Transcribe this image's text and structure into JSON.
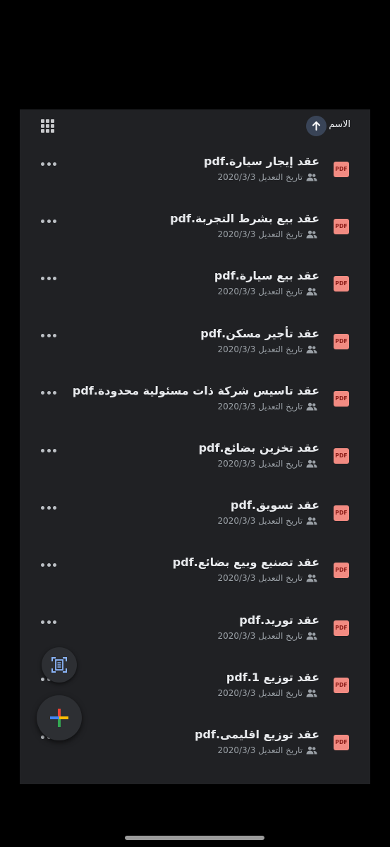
{
  "sort": {
    "label": "الاسم",
    "direction": "ascending"
  },
  "view_toggle_icon": "grid-view-icon",
  "file_type_badge": "PDF",
  "files": [
    {
      "name": "عقد إيجار سيارة.pdf",
      "meta": "تاريخ التعديل 2020/3/3"
    },
    {
      "name": "عقد بيع بشرط التجربة.pdf",
      "meta": "تاريخ التعديل 2020/3/3"
    },
    {
      "name": "عقد بيع سيارة.pdf",
      "meta": "تاريخ التعديل 2020/3/3"
    },
    {
      "name": "عقد تأجير مسكن.pdf",
      "meta": "تاريخ التعديل 2020/3/3"
    },
    {
      "name": "عقد تاسيس شركة ذات مسئولية محدودة.pdf",
      "meta": "تاريخ التعديل 2020/3/3"
    },
    {
      "name": "عقد تخزين بضائع.pdf",
      "meta": "تاريخ التعديل 2020/3/3"
    },
    {
      "name": "عقد تسويق.pdf",
      "meta": "تاريخ التعديل 2020/3/3"
    },
    {
      "name": "عقد تصنيع وبيع بضائع.pdf",
      "meta": "تاريخ التعديل 2020/3/3"
    },
    {
      "name": "عقد توريد.pdf",
      "meta": "تاريخ التعديل 2020/3/3"
    },
    {
      "name": "عقد توزيع 1.pdf",
      "meta": "تاريخ التعديل 2020/3/3"
    },
    {
      "name": "عقد توزيع اقليمى.pdf",
      "meta": "تاريخ التعديل 2020/3/3"
    }
  ],
  "colors": {
    "background": "#000000",
    "panel": "#202124",
    "pdf_badge": "#f28b82",
    "text_primary": "#e8eaed",
    "text_secondary": "#9aa0a6"
  }
}
